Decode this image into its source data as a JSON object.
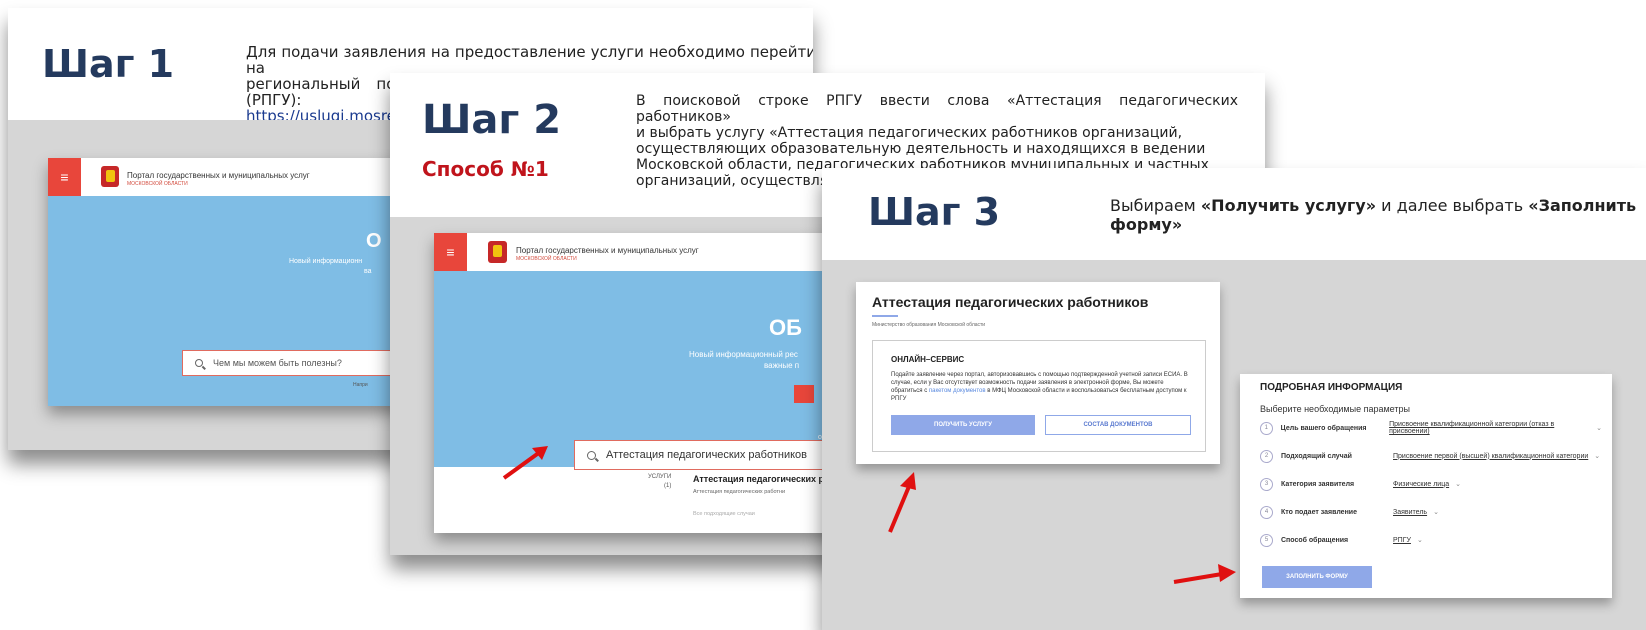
{
  "colors": {
    "title": "#243a5e",
    "accent_red": "#e8463b",
    "hero_blue": "#7fbde5",
    "way_red": "#c0141c",
    "button_blue": "#8fa8e8"
  },
  "step1": {
    "title": "Шаг 1",
    "desc_line1": "Для подачи заявления на предоставление услуги необходимо перейти на",
    "desc_line2": "региональный портал государственных и муниципальных услуг (РПГУ):",
    "desc_link": "https://uslugi.mosreg.ru",
    "portal": {
      "name": "Портал государственных и муниципальных услуг",
      "sub": "МОСКОВСКОЙ ОБЛАСТИ",
      "hero_big": "О",
      "hero_line1": "Новый информационн",
      "hero_line2": "ва",
      "search_placeholder": "Чем мы можем быть полезны?",
      "hint": "Напри"
    }
  },
  "step2": {
    "title": "Шаг 2",
    "way": "Способ №1",
    "desc": [
      "В поисковой строке РПГУ ввести слова «Аттестация педагогических работников»",
      "и выбрать услугу «Аттестация педагогических работников организаций,",
      "осуществляющих образовательную деятельность и находящихся в ведении",
      "Московской области, педагогических работников муниципальных и частных",
      "организаций, осуществляющих образовательную деятельность»."
    ],
    "portal": {
      "name": "Портал государственных и муниципальных услуг",
      "sub": "МОСКОВСКОЙ ОБЛАСТИ",
      "hero_big": "ОБ",
      "hero_line1": "Новый информационный рес",
      "hero_line2": "важные п",
      "hero_small": "о",
      "search_value": "Аттестация педагогических работников",
      "result_category": "УСЛУГИ",
      "result_count": "(1)",
      "result_title": "Аттестация педагогических р",
      "result_sub": "Аттестация педагогических работни",
      "result_all": "Все подходящие случаи"
    }
  },
  "step3": {
    "title": "Шаг 3",
    "desc_part1": "Выбираем ",
    "desc_bold1": "«Получить услугу»",
    "desc_part2": " и далее выбрать ",
    "desc_bold2": "«Заполнить",
    "desc_line2": "форму»",
    "card1": {
      "title": "Аттестация педагогических работников",
      "ministry": "Министерство образования Московской области",
      "online_title": "ОНЛАЙН–СЕРВИС",
      "online_text": "Подайте заявление через портал, авторизовавшись с помощью подтвержденной учетной записи ЕСИА. В случае, если у Вас отсутствует возможность подачи заявления в электронной форме, Вы можете обратиться с ",
      "online_link": "пакетом документов",
      "online_text2": " в МФЦ Московской области и воспользоваться бесплатным доступом к РПГУ",
      "btn_get": "ПОЛУЧИТЬ УСЛУГУ",
      "btn_docs": "СОСТАВ ДОКУМЕНТОВ"
    },
    "card2": {
      "title": "ПОДРОБНАЯ ИНФОРМАЦИЯ",
      "subtitle": "Выберите необходимые параметры",
      "params": [
        {
          "num": "1",
          "label": "Цель вашего обращения",
          "value": "Присвоение квалификационной категории (отказ в присвоении)"
        },
        {
          "num": "2",
          "label": "Подходящий случай",
          "value": "Присвоение первой (высшей) квалификационной категории"
        },
        {
          "num": "3",
          "label": "Категория заявителя",
          "value": "Физические лица"
        },
        {
          "num": "4",
          "label": "Кто подает заявление",
          "value": "Заявитель"
        },
        {
          "num": "5",
          "label": "Способ обращения",
          "value": "РПГУ"
        }
      ],
      "btn_fill": "ЗАПОЛНИТЬ ФОРМУ"
    }
  }
}
